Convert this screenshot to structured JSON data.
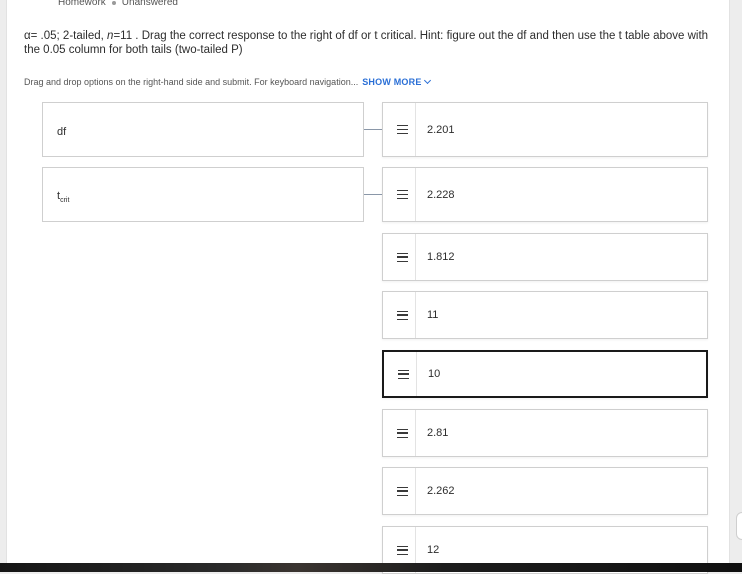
{
  "header": {
    "breadcrumb_type": "Homework",
    "breadcrumb_status": "Unanswered"
  },
  "question": {
    "alpha": "α= .05; 2-tailed, ",
    "n_var": "n",
    "n_value": "=11",
    "text": " . Drag the correct response to the right of df or t critical. Hint: figure out the df and then use the t table above with the 0.05 column for both tails (two-tailed P)"
  },
  "instructions": {
    "text": "Drag and drop options on the right-hand side and submit. For keyboard navigation...",
    "show_more": "SHOW MORE"
  },
  "targets": [
    {
      "label": "df",
      "sub": ""
    },
    {
      "label": "t",
      "sub": "crit"
    }
  ],
  "options": [
    "2.201",
    "2.228",
    "1.812",
    "11",
    "10",
    "2.81",
    "2.262",
    "12"
  ],
  "colors": {
    "accent": "#2a6fd6",
    "selected_border": "#1a1a1a",
    "border": "#cfcfcf"
  }
}
